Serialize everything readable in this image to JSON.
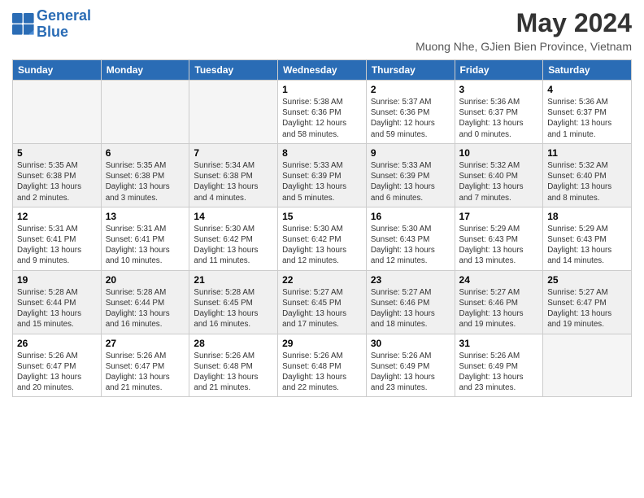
{
  "logo": {
    "name_line1": "General",
    "name_line2": "Blue"
  },
  "title": "May 2024",
  "subtitle": "Muong Nhe, GJien Bien Province, Vietnam",
  "days_of_week": [
    "Sunday",
    "Monday",
    "Tuesday",
    "Wednesday",
    "Thursday",
    "Friday",
    "Saturday"
  ],
  "weeks": [
    {
      "shaded": false,
      "days": [
        {
          "num": "",
          "empty": true
        },
        {
          "num": "",
          "empty": true
        },
        {
          "num": "",
          "empty": true
        },
        {
          "num": "1",
          "info": "Sunrise: 5:38 AM\nSunset: 6:36 PM\nDaylight: 12 hours\nand 58 minutes."
        },
        {
          "num": "2",
          "info": "Sunrise: 5:37 AM\nSunset: 6:36 PM\nDaylight: 12 hours\nand 59 minutes."
        },
        {
          "num": "3",
          "info": "Sunrise: 5:36 AM\nSunset: 6:37 PM\nDaylight: 13 hours\nand 0 minutes."
        },
        {
          "num": "4",
          "info": "Sunrise: 5:36 AM\nSunset: 6:37 PM\nDaylight: 13 hours\nand 1 minute."
        }
      ]
    },
    {
      "shaded": true,
      "days": [
        {
          "num": "5",
          "info": "Sunrise: 5:35 AM\nSunset: 6:38 PM\nDaylight: 13 hours\nand 2 minutes."
        },
        {
          "num": "6",
          "info": "Sunrise: 5:35 AM\nSunset: 6:38 PM\nDaylight: 13 hours\nand 3 minutes."
        },
        {
          "num": "7",
          "info": "Sunrise: 5:34 AM\nSunset: 6:38 PM\nDaylight: 13 hours\nand 4 minutes."
        },
        {
          "num": "8",
          "info": "Sunrise: 5:33 AM\nSunset: 6:39 PM\nDaylight: 13 hours\nand 5 minutes."
        },
        {
          "num": "9",
          "info": "Sunrise: 5:33 AM\nSunset: 6:39 PM\nDaylight: 13 hours\nand 6 minutes."
        },
        {
          "num": "10",
          "info": "Sunrise: 5:32 AM\nSunset: 6:40 PM\nDaylight: 13 hours\nand 7 minutes."
        },
        {
          "num": "11",
          "info": "Sunrise: 5:32 AM\nSunset: 6:40 PM\nDaylight: 13 hours\nand 8 minutes."
        }
      ]
    },
    {
      "shaded": false,
      "days": [
        {
          "num": "12",
          "info": "Sunrise: 5:31 AM\nSunset: 6:41 PM\nDaylight: 13 hours\nand 9 minutes."
        },
        {
          "num": "13",
          "info": "Sunrise: 5:31 AM\nSunset: 6:41 PM\nDaylight: 13 hours\nand 10 minutes."
        },
        {
          "num": "14",
          "info": "Sunrise: 5:30 AM\nSunset: 6:42 PM\nDaylight: 13 hours\nand 11 minutes."
        },
        {
          "num": "15",
          "info": "Sunrise: 5:30 AM\nSunset: 6:42 PM\nDaylight: 13 hours\nand 12 minutes."
        },
        {
          "num": "16",
          "info": "Sunrise: 5:30 AM\nSunset: 6:43 PM\nDaylight: 13 hours\nand 12 minutes."
        },
        {
          "num": "17",
          "info": "Sunrise: 5:29 AM\nSunset: 6:43 PM\nDaylight: 13 hours\nand 13 minutes."
        },
        {
          "num": "18",
          "info": "Sunrise: 5:29 AM\nSunset: 6:43 PM\nDaylight: 13 hours\nand 14 minutes."
        }
      ]
    },
    {
      "shaded": true,
      "days": [
        {
          "num": "19",
          "info": "Sunrise: 5:28 AM\nSunset: 6:44 PM\nDaylight: 13 hours\nand 15 minutes."
        },
        {
          "num": "20",
          "info": "Sunrise: 5:28 AM\nSunset: 6:44 PM\nDaylight: 13 hours\nand 16 minutes."
        },
        {
          "num": "21",
          "info": "Sunrise: 5:28 AM\nSunset: 6:45 PM\nDaylight: 13 hours\nand 16 minutes."
        },
        {
          "num": "22",
          "info": "Sunrise: 5:27 AM\nSunset: 6:45 PM\nDaylight: 13 hours\nand 17 minutes."
        },
        {
          "num": "23",
          "info": "Sunrise: 5:27 AM\nSunset: 6:46 PM\nDaylight: 13 hours\nand 18 minutes."
        },
        {
          "num": "24",
          "info": "Sunrise: 5:27 AM\nSunset: 6:46 PM\nDaylight: 13 hours\nand 19 minutes."
        },
        {
          "num": "25",
          "info": "Sunrise: 5:27 AM\nSunset: 6:47 PM\nDaylight: 13 hours\nand 19 minutes."
        }
      ]
    },
    {
      "shaded": false,
      "days": [
        {
          "num": "26",
          "info": "Sunrise: 5:26 AM\nSunset: 6:47 PM\nDaylight: 13 hours\nand 20 minutes."
        },
        {
          "num": "27",
          "info": "Sunrise: 5:26 AM\nSunset: 6:47 PM\nDaylight: 13 hours\nand 21 minutes."
        },
        {
          "num": "28",
          "info": "Sunrise: 5:26 AM\nSunset: 6:48 PM\nDaylight: 13 hours\nand 21 minutes."
        },
        {
          "num": "29",
          "info": "Sunrise: 5:26 AM\nSunset: 6:48 PM\nDaylight: 13 hours\nand 22 minutes."
        },
        {
          "num": "30",
          "info": "Sunrise: 5:26 AM\nSunset: 6:49 PM\nDaylight: 13 hours\nand 23 minutes."
        },
        {
          "num": "31",
          "info": "Sunrise: 5:26 AM\nSunset: 6:49 PM\nDaylight: 13 hours\nand 23 minutes."
        },
        {
          "num": "",
          "empty": true
        }
      ]
    }
  ]
}
